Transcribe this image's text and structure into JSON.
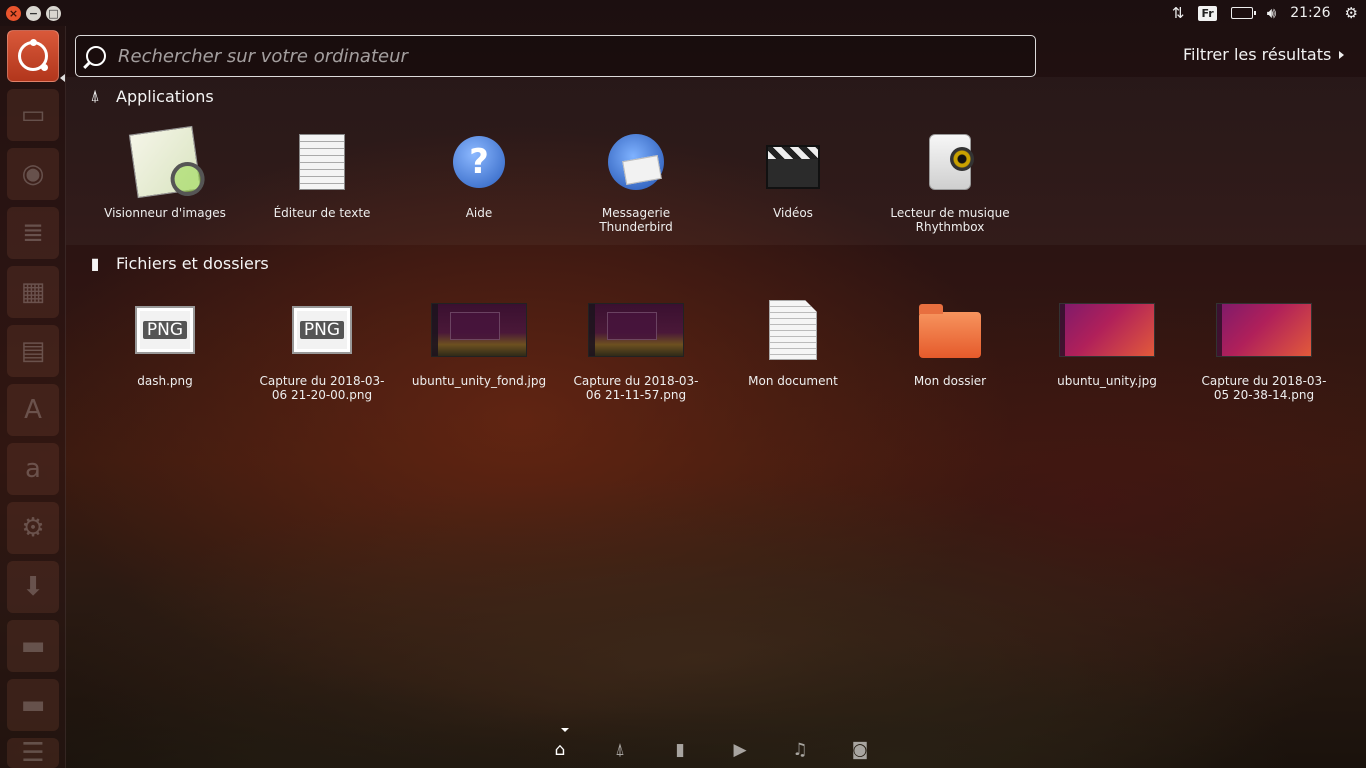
{
  "top_panel": {
    "clock": "21:26",
    "keyboard_layout": "Fr",
    "icons": [
      "close-icon",
      "minimize-icon",
      "maximize-icon",
      "network-icon",
      "keyboard-icon",
      "battery-icon",
      "volume-icon",
      "settings-gear-icon"
    ]
  },
  "search": {
    "placeholder": "Rechercher sur votre ordinateur",
    "value": ""
  },
  "filter": {
    "label": "Filtrer les résultats"
  },
  "sections": {
    "applications": {
      "title": "Applications",
      "items": [
        {
          "label": "Visionneur d'images",
          "icon": "image-viewer-icon"
        },
        {
          "label": "Éditeur de texte",
          "icon": "text-editor-icon"
        },
        {
          "label": "Aide",
          "icon": "help-icon"
        },
        {
          "label": "Messagerie Thunderbird",
          "icon": "thunderbird-icon"
        },
        {
          "label": "Vidéos",
          "icon": "videos-icon"
        },
        {
          "label": "Lecteur de musique Rhythmbox",
          "icon": "rhythmbox-icon"
        }
      ]
    },
    "files": {
      "title": "Fichiers et dossiers",
      "items": [
        {
          "label": "dash.png",
          "icon": "png-file-icon",
          "badge": "PNG"
        },
        {
          "label": "Capture du 2018-03-06 21-20-00.png",
          "icon": "png-file-icon",
          "badge": "PNG"
        },
        {
          "label": "ubuntu_unity_fond.jpg",
          "icon": "screenshot-thumbnail-icon"
        },
        {
          "label": "Capture du 2018-03-06 21-11-57.png",
          "icon": "screenshot-thumbnail-icon"
        },
        {
          "label": "Mon document",
          "icon": "document-icon"
        },
        {
          "label": "Mon dossier",
          "icon": "folder-icon"
        },
        {
          "label": "ubuntu_unity.jpg",
          "icon": "wallpaper-thumbnail-icon"
        },
        {
          "label": "Capture du 2018-03-05 20-38-14.png",
          "icon": "wallpaper-thumbnail-icon"
        }
      ]
    }
  },
  "launcher": {
    "items": [
      "ubuntu-logo-icon",
      "files-icon",
      "firefox-icon",
      "writer-icon",
      "calc-icon",
      "impress-icon",
      "software-center-icon",
      "amazon-icon",
      "system-settings-icon",
      "installer-icon",
      "drive-icon",
      "drive-icon",
      "workspace-switcher-icon"
    ]
  },
  "lenses": [
    "home-lens-icon",
    "applications-lens-icon",
    "files-lens-icon",
    "video-lens-icon",
    "music-lens-icon",
    "photo-lens-icon"
  ]
}
